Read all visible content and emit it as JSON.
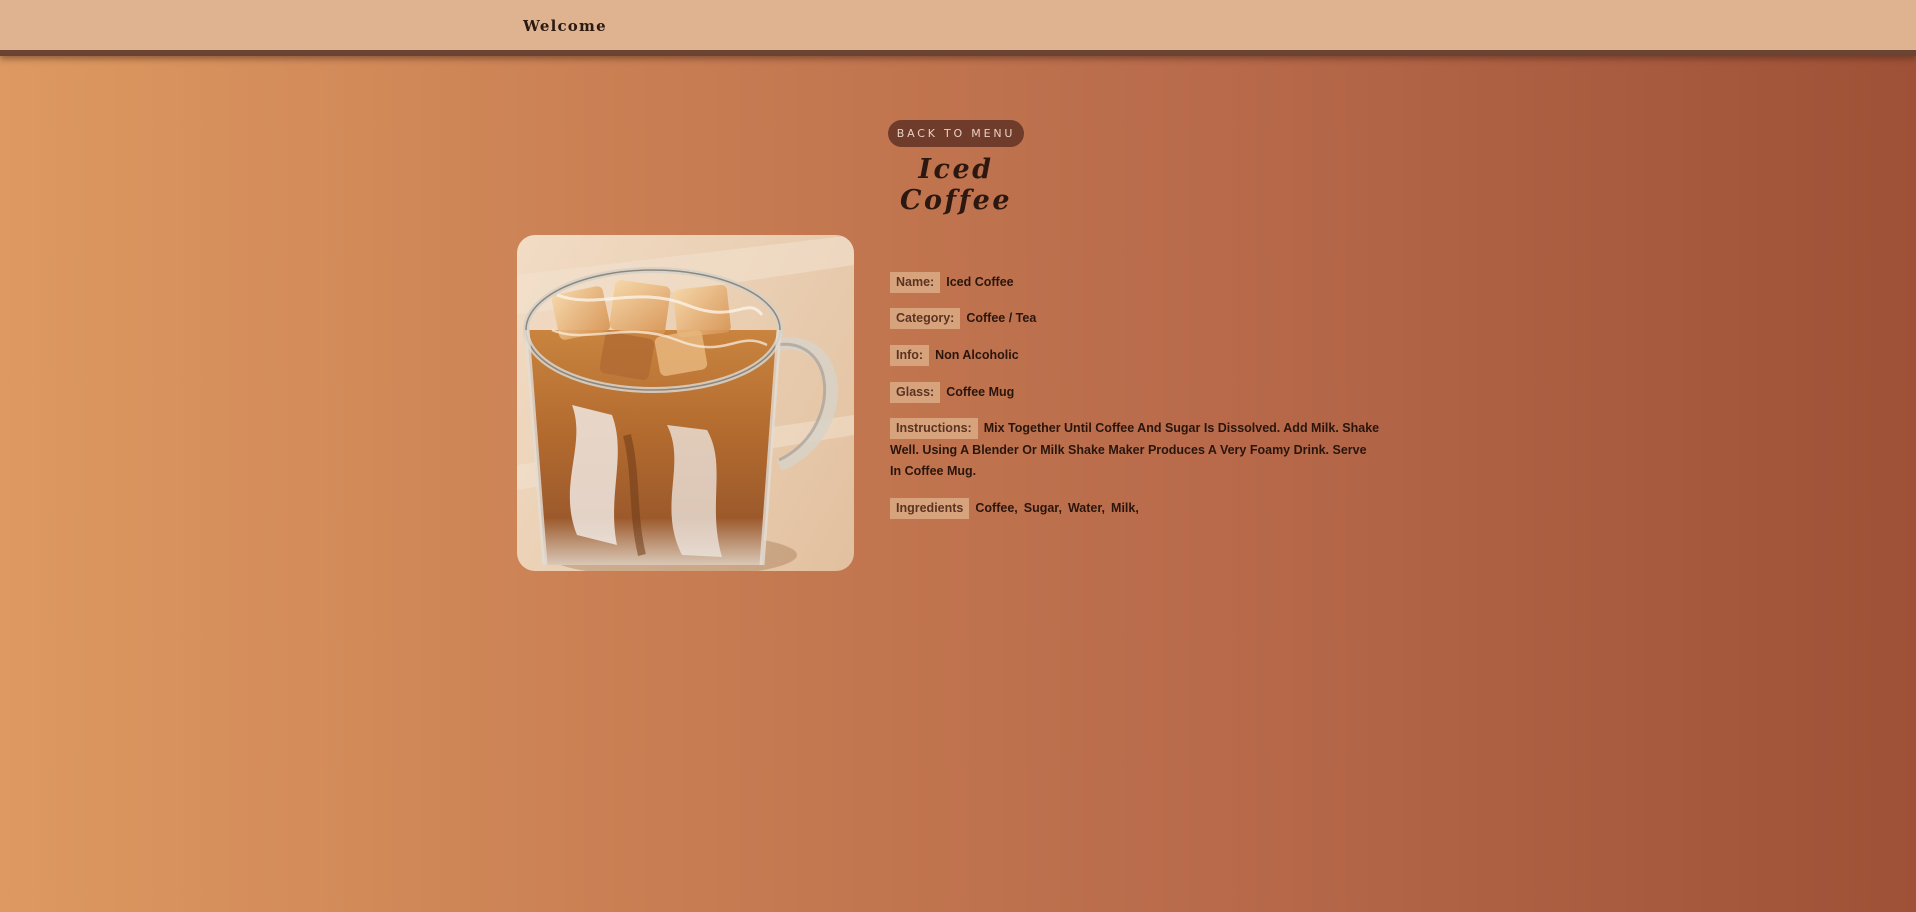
{
  "header": {
    "brand": "Welcome"
  },
  "nav": {
    "back_label": "BACK TO MENU"
  },
  "drink": {
    "title": "Iced Coffee",
    "image_alt": "Iced Coffee",
    "fields": {
      "name_label": "Name:",
      "name_value": "Iced Coffee",
      "category_label": "Category:",
      "category_value": "Coffee / Tea",
      "info_label": "Info:",
      "info_value": "Non Alcoholic",
      "glass_label": "Glass:",
      "glass_value": "Coffee Mug",
      "instructions_label": "Instructions:",
      "instructions_value": "Mix Together Until Coffee And Sugar Is Dissolved. Add Milk. Shake Well. Using A Blender Or Milk Shake Maker Produces A Very Foamy Drink. Serve In Coffee Mug.",
      "ingredients_label": "Ingredients"
    },
    "ingredients": [
      "Coffee,",
      "Sugar,",
      "Water,",
      "Milk,"
    ]
  },
  "colors": {
    "background_start": "#dd9961",
    "background_end": "#9f5137",
    "header_bg": "#dfb290",
    "button_bg": "#6f3c2b",
    "label_bg": "#d7a37c"
  }
}
